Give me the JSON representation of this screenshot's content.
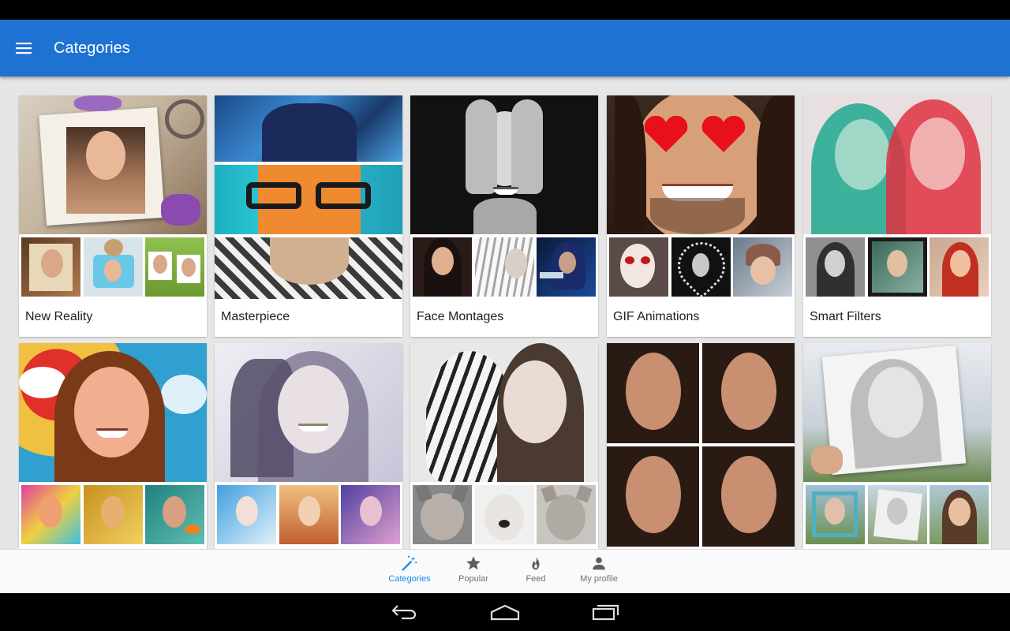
{
  "app_bar": {
    "title": "Categories"
  },
  "categories": [
    {
      "label": "New Reality",
      "hero": "photo-frame-collage",
      "thumbs": [
        "frame-photo",
        "dog-frame",
        "clothesline-photos"
      ]
    },
    {
      "label": "Masterpiece",
      "hero": "art-style-man-glasses",
      "thumbs": []
    },
    {
      "label": "Face Montages",
      "hero": "hands-over-face-bw",
      "thumbs": [
        "nun-portrait",
        "tiger-face-blend",
        "blue-hood-man"
      ]
    },
    {
      "label": "GIF Animations",
      "hero": "heart-eyes-man",
      "thumbs": [
        "skull-makeup",
        "heart-frame",
        "snow-girl"
      ]
    },
    {
      "label": "Smart Filters",
      "hero": "duotone-girl",
      "thumbs": [
        "bw-girl",
        "framed-girl",
        "red-girl"
      ]
    },
    {
      "label": "",
      "hero": "pop-art-girl",
      "thumbs": [
        "rainbow-girl",
        "gold-girl",
        "fish-girl"
      ]
    },
    {
      "label": "",
      "hero": "double-exposure-girl",
      "thumbs": [
        "blue-watercolor",
        "sunset-girl",
        "purple-girl"
      ]
    },
    {
      "label": "",
      "hero": "tiger-girl-bw",
      "thumbs": [
        "wolf-face",
        "dog-face",
        "cat-face"
      ]
    },
    {
      "label": "",
      "hero": "four-expressions",
      "thumbs": []
    },
    {
      "label": "",
      "hero": "pencil-sketch-paper",
      "thumbs": [
        "frame-sketch",
        "paper-sketch",
        "nature-girl"
      ]
    }
  ],
  "bottom_nav": [
    {
      "label": "Categories",
      "icon": "magic-wand-icon",
      "active": true
    },
    {
      "label": "Popular",
      "icon": "star-icon",
      "active": false
    },
    {
      "label": "Feed",
      "icon": "flame-icon",
      "active": false
    },
    {
      "label": "My profile",
      "icon": "person-icon",
      "active": false
    }
  ],
  "colors": {
    "app_bar": "#1e72d2",
    "active_tab": "#1e88e5",
    "inactive_tab": "#707070"
  }
}
